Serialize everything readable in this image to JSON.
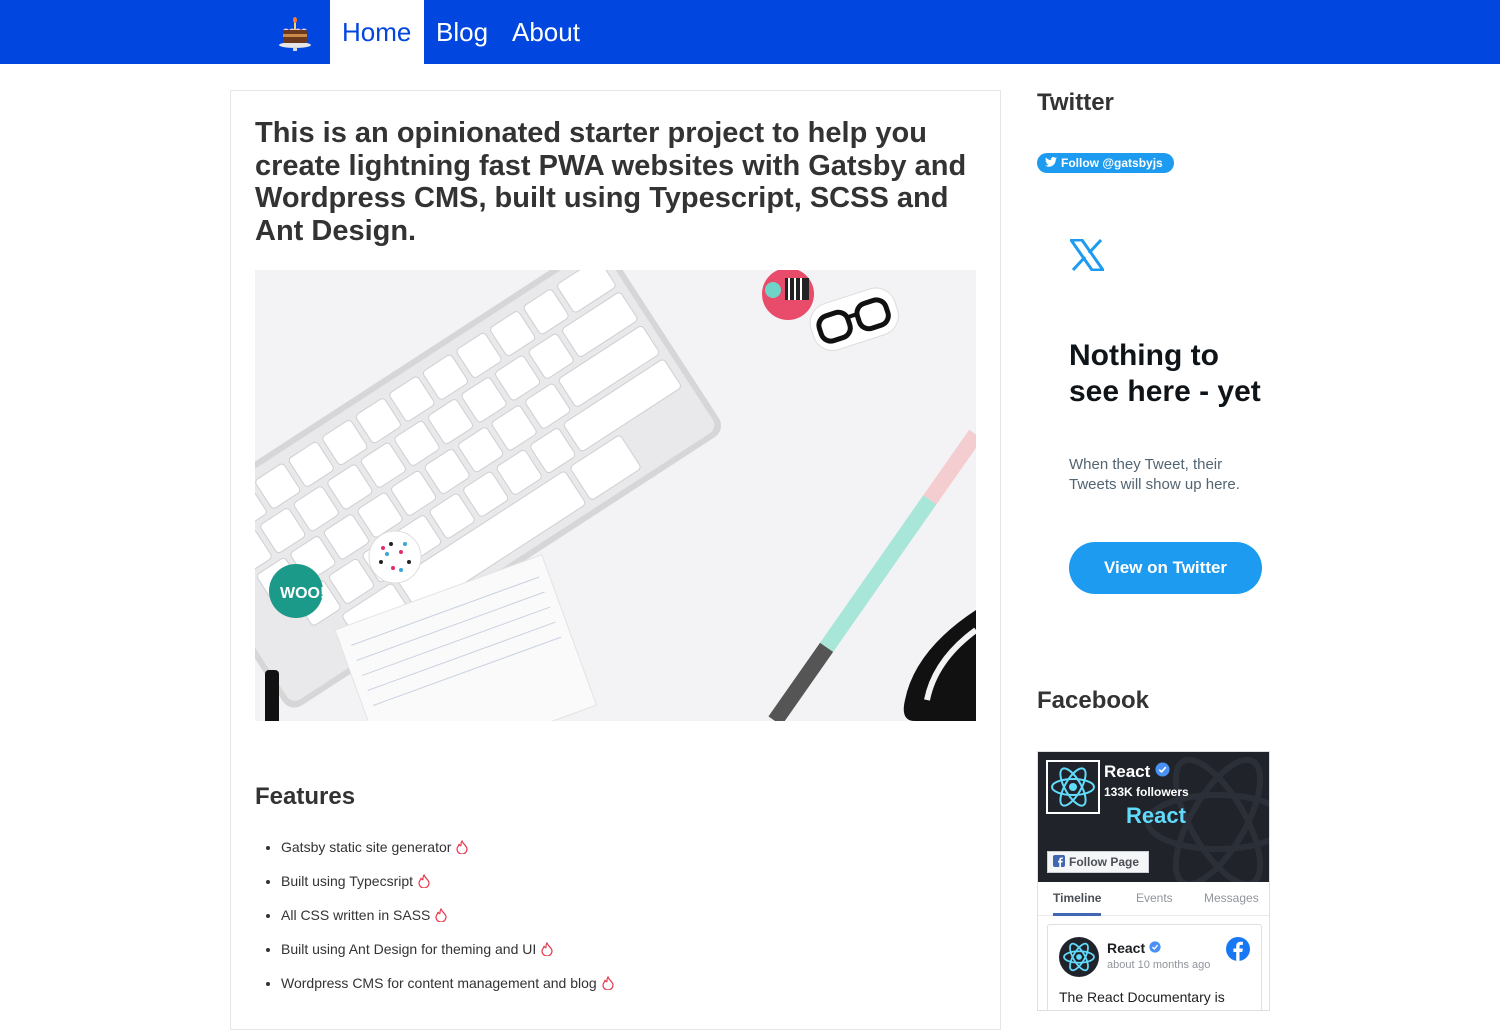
{
  "nav": {
    "logo_icon": "birthday-cake-icon",
    "items": [
      {
        "label": "Home",
        "active": true
      },
      {
        "label": "Blog",
        "active": false
      },
      {
        "label": "About",
        "active": false
      }
    ],
    "background": "#0046df"
  },
  "main": {
    "headline": "This is an opinionated starter project to help you create lightning fast PWA websites with Gatsby and Wordpress CMS, built using Typescript, SCSS and Ant Design.",
    "features_title": "Features",
    "features": [
      "Gatsby static site generator",
      "Built using Typecsript",
      "All CSS written in SASS",
      "Built using Ant Design for theming and UI",
      "Wordpress CMS for content management and blog"
    ],
    "feature_icon": "flame-icon"
  },
  "sidebar": {
    "twitter": {
      "title": "Twitter",
      "follow_label": "Follow @gatsbyjs",
      "empty_title": "Nothing to see here - yet",
      "empty_text": "When they Tweet, their Tweets will show up here.",
      "view_button": "View on Twitter",
      "accent": "#1d9bf0"
    },
    "facebook": {
      "title": "Facebook",
      "page_name": "React",
      "followers": "133K followers",
      "cover_text": "React",
      "follow_label": "Follow Page",
      "tabs": [
        "Timeline",
        "Events",
        "Messages"
      ],
      "active_tab": "Timeline",
      "post": {
        "author": "React",
        "time": "about 10 months ago",
        "text": "The React Documentary is"
      },
      "accent": "#4267b2"
    }
  }
}
